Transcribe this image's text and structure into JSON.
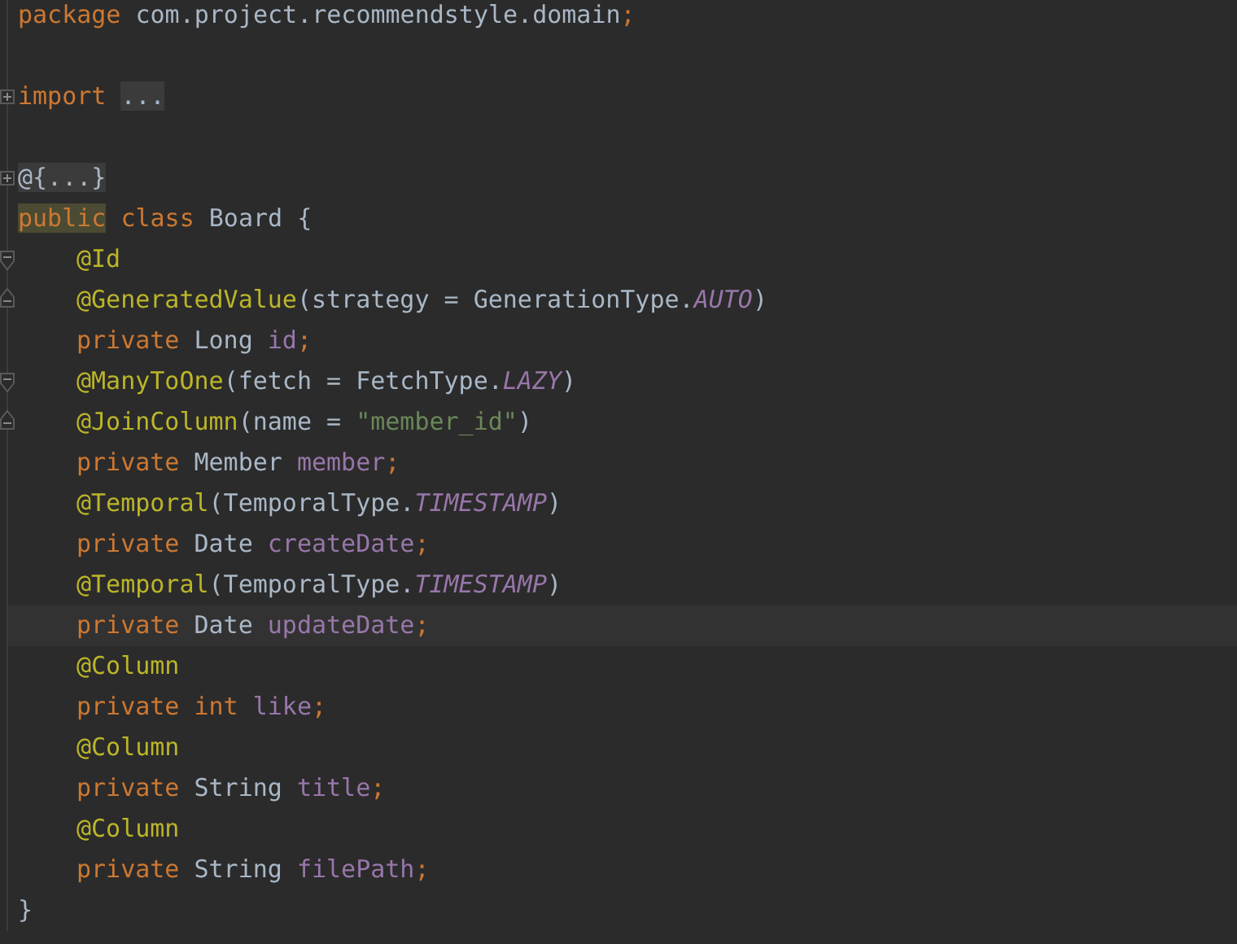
{
  "editor": {
    "lines": [
      {
        "kind": "code",
        "tokens": [
          {
            "text": "package ",
            "kind": "keyword"
          },
          {
            "text": "com.project.recommendstyle.domain",
            "kind": "plain"
          },
          {
            "text": ";",
            "kind": "keyword"
          }
        ]
      },
      {
        "kind": "blank"
      },
      {
        "kind": "code",
        "collapsed": true,
        "tokens": [
          {
            "text": "import ",
            "kind": "keyword"
          },
          {
            "text": "...",
            "kind": "folded"
          }
        ]
      },
      {
        "kind": "blank"
      },
      {
        "kind": "code",
        "collapsed": true,
        "tokens": [
          {
            "text": "@{...}",
            "kind": "folded"
          }
        ]
      },
      {
        "kind": "code",
        "tokens": [
          {
            "text": "public",
            "kind": "highlighted"
          },
          {
            "text": " class ",
            "kind": "keyword"
          },
          {
            "text": "Board {",
            "kind": "plain"
          }
        ],
        "children": [
          {
            "kind": "code",
            "fold_start": true,
            "tokens": [
              {
                "text": "@Id",
                "kind": "annotation"
              }
            ]
          },
          {
            "kind": "code",
            "fold_end": true,
            "tokens": [
              {
                "text": "@GeneratedValue",
                "kind": "annotation"
              },
              {
                "text": "(strategy = GenerationType.",
                "kind": "plain"
              },
              {
                "text": "AUTO",
                "kind": "constant"
              },
              {
                "text": ")",
                "kind": "plain"
              }
            ]
          },
          {
            "kind": "code",
            "tokens": [
              {
                "text": "private ",
                "kind": "keyword"
              },
              {
                "text": "Long ",
                "kind": "plain"
              },
              {
                "text": "id",
                "kind": "field"
              },
              {
                "text": ";",
                "kind": "keyword"
              }
            ]
          },
          {
            "kind": "code",
            "fold_start": true,
            "tokens": [
              {
                "text": "@ManyToOne",
                "kind": "annotation"
              },
              {
                "text": "(fetch = FetchType.",
                "kind": "plain"
              },
              {
                "text": "LAZY",
                "kind": "constant"
              },
              {
                "text": ")",
                "kind": "plain"
              }
            ]
          },
          {
            "kind": "code",
            "fold_end": true,
            "tokens": [
              {
                "text": "@JoinColumn",
                "kind": "annotation"
              },
              {
                "text": "(name = ",
                "kind": "plain"
              },
              {
                "text": "\"member_id\"",
                "kind": "string"
              },
              {
                "text": ")",
                "kind": "plain"
              }
            ]
          },
          {
            "kind": "code",
            "tokens": [
              {
                "text": "private ",
                "kind": "keyword"
              },
              {
                "text": "Member ",
                "kind": "plain"
              },
              {
                "text": "member",
                "kind": "field"
              },
              {
                "text": ";",
                "kind": "keyword"
              }
            ]
          },
          {
            "kind": "code",
            "tokens": [
              {
                "text": "@Temporal",
                "kind": "annotation"
              },
              {
                "text": "(TemporalType.",
                "kind": "plain"
              },
              {
                "text": "TIMESTAMP",
                "kind": "constant"
              },
              {
                "text": ")",
                "kind": "plain"
              }
            ]
          },
          {
            "kind": "code",
            "tokens": [
              {
                "text": "private ",
                "kind": "keyword"
              },
              {
                "text": "Date ",
                "kind": "plain"
              },
              {
                "text": "createDate",
                "kind": "field"
              },
              {
                "text": ";",
                "kind": "keyword"
              }
            ]
          },
          {
            "kind": "code",
            "tokens": [
              {
                "text": "@Temporal",
                "kind": "annotation"
              },
              {
                "text": "(TemporalType.",
                "kind": "plain"
              },
              {
                "text": "TIMESTAMP",
                "kind": "constant"
              },
              {
                "text": ")",
                "kind": "plain"
              }
            ]
          },
          {
            "kind": "code",
            "current": true,
            "tokens": [
              {
                "text": "private ",
                "kind": "keyword"
              },
              {
                "text": "Date ",
                "kind": "plain"
              },
              {
                "text": "updateDate",
                "kind": "field"
              },
              {
                "text": ";",
                "kind": "keyword"
              }
            ]
          },
          {
            "kind": "code",
            "tokens": [
              {
                "text": "@Column",
                "kind": "annotation"
              }
            ]
          },
          {
            "kind": "code",
            "tokens": [
              {
                "text": "private ",
                "kind": "keyword"
              },
              {
                "text": "int ",
                "kind": "keyword"
              },
              {
                "text": "like",
                "kind": "field"
              },
              {
                "text": ";",
                "kind": "keyword"
              }
            ]
          },
          {
            "kind": "code",
            "tokens": [
              {
                "text": "@Column",
                "kind": "annotation"
              }
            ]
          },
          {
            "kind": "code",
            "tokens": [
              {
                "text": "private ",
                "kind": "keyword"
              },
              {
                "text": "String ",
                "kind": "plain"
              },
              {
                "text": "title",
                "kind": "field"
              },
              {
                "text": ";",
                "kind": "keyword"
              }
            ]
          },
          {
            "kind": "code",
            "tokens": [
              {
                "text": "@Column",
                "kind": "annotation"
              }
            ]
          },
          {
            "kind": "code",
            "tokens": [
              {
                "text": "private ",
                "kind": "keyword"
              },
              {
                "text": "String ",
                "kind": "plain"
              },
              {
                "text": "filePath",
                "kind": "field"
              },
              {
                "text": ";",
                "kind": "keyword"
              }
            ]
          }
        ]
      },
      {
        "kind": "code",
        "tokens": [
          {
            "text": "}",
            "kind": "plain"
          }
        ]
      }
    ]
  }
}
